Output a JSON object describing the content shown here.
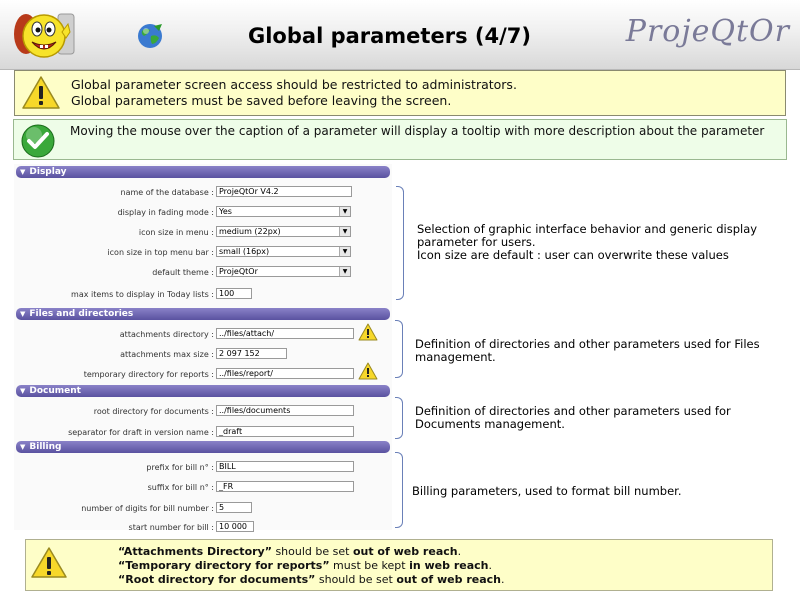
{
  "header": {
    "title": "Global parameters (4/7)",
    "brand": "ProjeQtOr",
    "mascot_icon": "smiley-mascot-icon",
    "globe_icon": "globe-icon"
  },
  "warning": {
    "line1": "Global parameter screen access should be restricted to administrators.",
    "line2": "Global parameters must be saved before leaving the screen."
  },
  "tip": {
    "text": "Moving the mouse over the caption of a parameter will display a tooltip with more description about the parameter"
  },
  "sections": {
    "display": {
      "title": "Display",
      "db_name_label": "name of the database :",
      "db_name_value": "ProjeQtOr V4.2",
      "fading_label": "display in fading mode :",
      "fading_value": "Yes",
      "icon_menu_label": "icon size in menu :",
      "icon_menu_value": "medium (22px)",
      "icon_topbar_label": "icon size in top menu bar :",
      "icon_topbar_value": "small (16px)",
      "theme_label": "default theme :",
      "theme_value": "ProjeQtOr",
      "today_label": "max items to display in Today lists :",
      "today_value": "100"
    },
    "files": {
      "title": "Files and directories",
      "attach_dir_label": "attachments directory :",
      "attach_dir_value": "../files/attach/",
      "attach_max_label": "attachments max size :",
      "attach_max_value": "2 097 152",
      "temp_dir_label": "temporary directory for reports :",
      "temp_dir_value": "../files/report/"
    },
    "document": {
      "title": "Document",
      "root_dir_label": "root directory for documents :",
      "root_dir_value": "../files/documents",
      "separator_label": "separator for draft in version name :",
      "separator_value": "_draft"
    },
    "billing": {
      "title": "Billing",
      "prefix_label": "prefix for bill n° :",
      "prefix_value": "BILL",
      "suffix_label": "suffix for bill n° :",
      "suffix_value": "_FR",
      "digits_label": "number of digits for bill number :",
      "digits_value": "5",
      "start_label": "start number for bill :",
      "start_value": "10 000"
    }
  },
  "descriptions": {
    "display_1": "Selection of graphic interface behavior and generic display",
    "display_2": "parameter for users.",
    "display_3": "Icon size are default : user can overwrite these values",
    "files_1": "Definition of directories and other parameters used for Files",
    "files_2": "management.",
    "document_1": "Definition of directories and other parameters used for",
    "document_2": "Documents management.",
    "billing_1": "Billing parameters, used to format bill number."
  },
  "note": {
    "l1_a": "“Attachments Directory”",
    "l1_b": " should be set ",
    "l1_c": "out of web reach",
    "l1_d": ".",
    "l2_a": "“Temporary directory for reports”",
    "l2_b": " must be kept ",
    "l2_c": "in web reach",
    "l2_d": ".",
    "l3_a": "“Root directory for documents”",
    "l3_b": " should be set ",
    "l3_c": "out of web reach",
    "l3_d": "."
  }
}
